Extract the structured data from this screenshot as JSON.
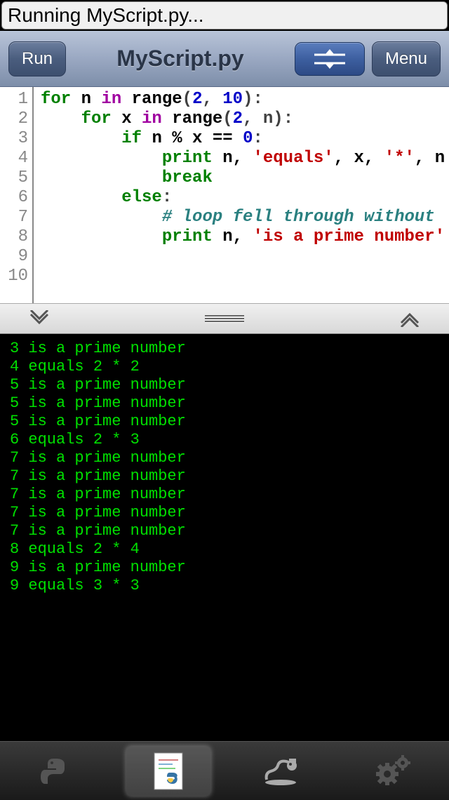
{
  "status": {
    "text": "Running MyScript.py..."
  },
  "toolbar": {
    "run_label": "Run",
    "title": "MyScript.py",
    "menu_label": "Menu"
  },
  "editor": {
    "line_numbers": [
      "1",
      "2",
      "3",
      "4",
      "5",
      "6",
      "7",
      "8",
      "9",
      "10"
    ],
    "lines": [
      [
        {
          "t": "for ",
          "c": "kw"
        },
        {
          "t": "n ",
          "c": "ident"
        },
        {
          "t": "in ",
          "c": "kw2"
        },
        {
          "t": "range",
          "c": "ident"
        },
        {
          "t": "(",
          "c": "op"
        },
        {
          "t": "2",
          "c": "num"
        },
        {
          "t": ", ",
          "c": "op"
        },
        {
          "t": "10",
          "c": "num"
        },
        {
          "t": "):",
          "c": "op"
        }
      ],
      [
        {
          "t": "    ",
          "c": ""
        },
        {
          "t": "for ",
          "c": "kw"
        },
        {
          "t": "x ",
          "c": "ident"
        },
        {
          "t": "in ",
          "c": "kw2"
        },
        {
          "t": "range",
          "c": "ident"
        },
        {
          "t": "(",
          "c": "op"
        },
        {
          "t": "2",
          "c": "num"
        },
        {
          "t": ", n):",
          "c": "op"
        }
      ],
      [
        {
          "t": "        ",
          "c": ""
        },
        {
          "t": "if ",
          "c": "kw"
        },
        {
          "t": "n % x == ",
          "c": "ident"
        },
        {
          "t": "0",
          "c": "num"
        },
        {
          "t": ":",
          "c": "op"
        }
      ],
      [
        {
          "t": "            ",
          "c": ""
        },
        {
          "t": "print ",
          "c": "kw"
        },
        {
          "t": "n, ",
          "c": "ident"
        },
        {
          "t": "'equals'",
          "c": "str"
        },
        {
          "t": ", x, ",
          "c": "ident"
        },
        {
          "t": "'*'",
          "c": "str"
        },
        {
          "t": ", n",
          "c": "ident"
        }
      ],
      [
        {
          "t": "            ",
          "c": ""
        },
        {
          "t": "break",
          "c": "kw"
        }
      ],
      [
        {
          "t": "        ",
          "c": ""
        },
        {
          "t": "else",
          "c": "kw"
        },
        {
          "t": ":",
          "c": "op"
        }
      ],
      [
        {
          "t": "            ",
          "c": ""
        },
        {
          "t": "# loop fell through without ",
          "c": "cmt"
        }
      ],
      [
        {
          "t": "            ",
          "c": ""
        },
        {
          "t": "print ",
          "c": "kw"
        },
        {
          "t": "n, ",
          "c": "ident"
        },
        {
          "t": "'is a prime number'",
          "c": "str"
        }
      ],
      [],
      []
    ]
  },
  "console": {
    "lines": [
      "3 is a prime number",
      "4 equals 2 * 2",
      "5 is a prime number",
      "5 is a prime number",
      "5 is a prime number",
      "6 equals 2 * 3",
      "7 is a prime number",
      "7 is a prime number",
      "7 is a prime number",
      "7 is a prime number",
      "7 is a prime number",
      "8 equals 2 * 4",
      "9 is a prime number",
      "9 equals 3 * 3"
    ]
  },
  "icons": {
    "split": "split-icon",
    "chev_down": "chevron-down-icon",
    "chev_up": "chevron-up-icon",
    "handle": "drag-handle-icon",
    "python": "python-icon",
    "doc": "document-icon",
    "snake": "snake-icon",
    "gear": "gear-icon"
  }
}
